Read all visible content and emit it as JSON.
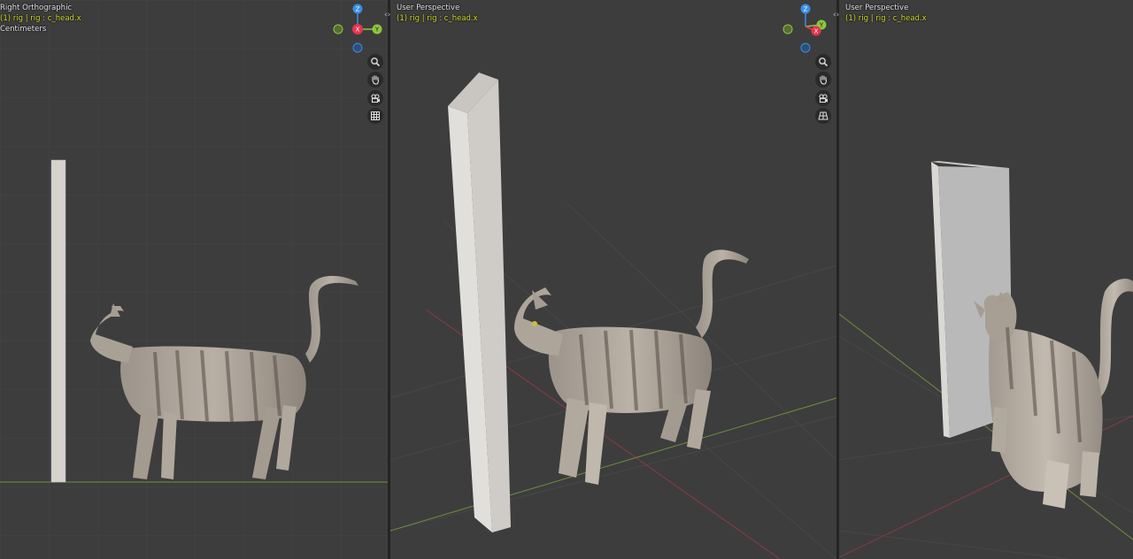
{
  "viewports": [
    {
      "view_name": "Right Orthographic",
      "object_info": "(1) rig | rig : c_head.x",
      "units": "Centimeters"
    },
    {
      "view_name": "User Perspective",
      "object_info": "(1) rig | rig : c_head.x"
    },
    {
      "view_name": "User Perspective",
      "object_info": "(1) rig | rig : c_head.x"
    }
  ],
  "gizmo": {
    "x_label": "X",
    "y_label": "Y",
    "z_label": "Z"
  },
  "nav_icons": [
    "zoom-icon",
    "hand-pan-icon",
    "camera-icon",
    "grid-icon"
  ],
  "colors": {
    "background": "#3d3d3d",
    "x_axis": "#e8344f",
    "y_axis": "#8cc63f",
    "z_axis": "#3a8ee6",
    "text_active_object": "#d8dd2a"
  }
}
